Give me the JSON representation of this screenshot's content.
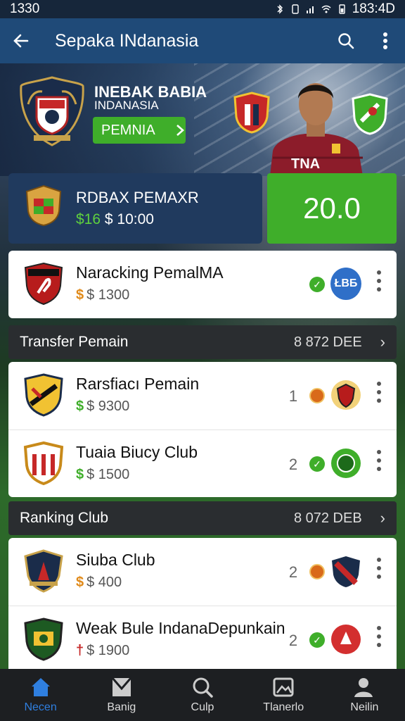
{
  "status_bar": {
    "time": "1330",
    "right_time": "183:4D"
  },
  "app_bar": {
    "title": "Sepakа INdanasia"
  },
  "hero": {
    "title": "INEBAK BABIA",
    "subtitle": "INDANASIA",
    "cta_label": "PEMNIA",
    "player_shirt_text": "TNA"
  },
  "promo": {
    "title": "RDBAX PEMAXR",
    "amount_symbol": "$16",
    "amount_value": "$ 10:00",
    "score": "20.0"
  },
  "featured": [
    {
      "name": "Naracking PemalMA",
      "symbol": "$",
      "price": "$ 1300",
      "badge_text": "ŁBБ"
    }
  ],
  "section_transfer": {
    "label": "Transfer Pemain",
    "meta": "8 872 DEE"
  },
  "transfer_rows": [
    {
      "name": "Rarsfiacı Pemain",
      "symbol": "$",
      "price": "$ 9300",
      "number": "1"
    },
    {
      "name": "Tuaia Biucy Club",
      "symbol": "$",
      "price": "$ 1500",
      "number": "2"
    }
  ],
  "section_ranking": {
    "label": "Ranking Club",
    "meta": "8 072 DEB"
  },
  "ranking_rows": [
    {
      "name": "Siuba Club",
      "symbol": "$",
      "price": "$ 400",
      "number": "2"
    },
    {
      "name": "Weak Bule IndanaDepunkain",
      "symbol": "†",
      "price": "$ 1900",
      "number": "2"
    }
  ],
  "bottom_nav": [
    {
      "label": "Necen",
      "icon": "home-icon",
      "active": true
    },
    {
      "label": "Banig",
      "icon": "shield-icon",
      "active": false
    },
    {
      "label": "Culp",
      "icon": "search-icon",
      "active": false
    },
    {
      "label": "Tlanerlo",
      "icon": "gallery-icon",
      "active": false
    },
    {
      "label": "Neilin",
      "icon": "profile-icon",
      "active": false
    }
  ],
  "colors": {
    "accent_green": "#3fae2a",
    "app_bar": "#1f4a78",
    "nav_active": "#2f7fe0"
  }
}
